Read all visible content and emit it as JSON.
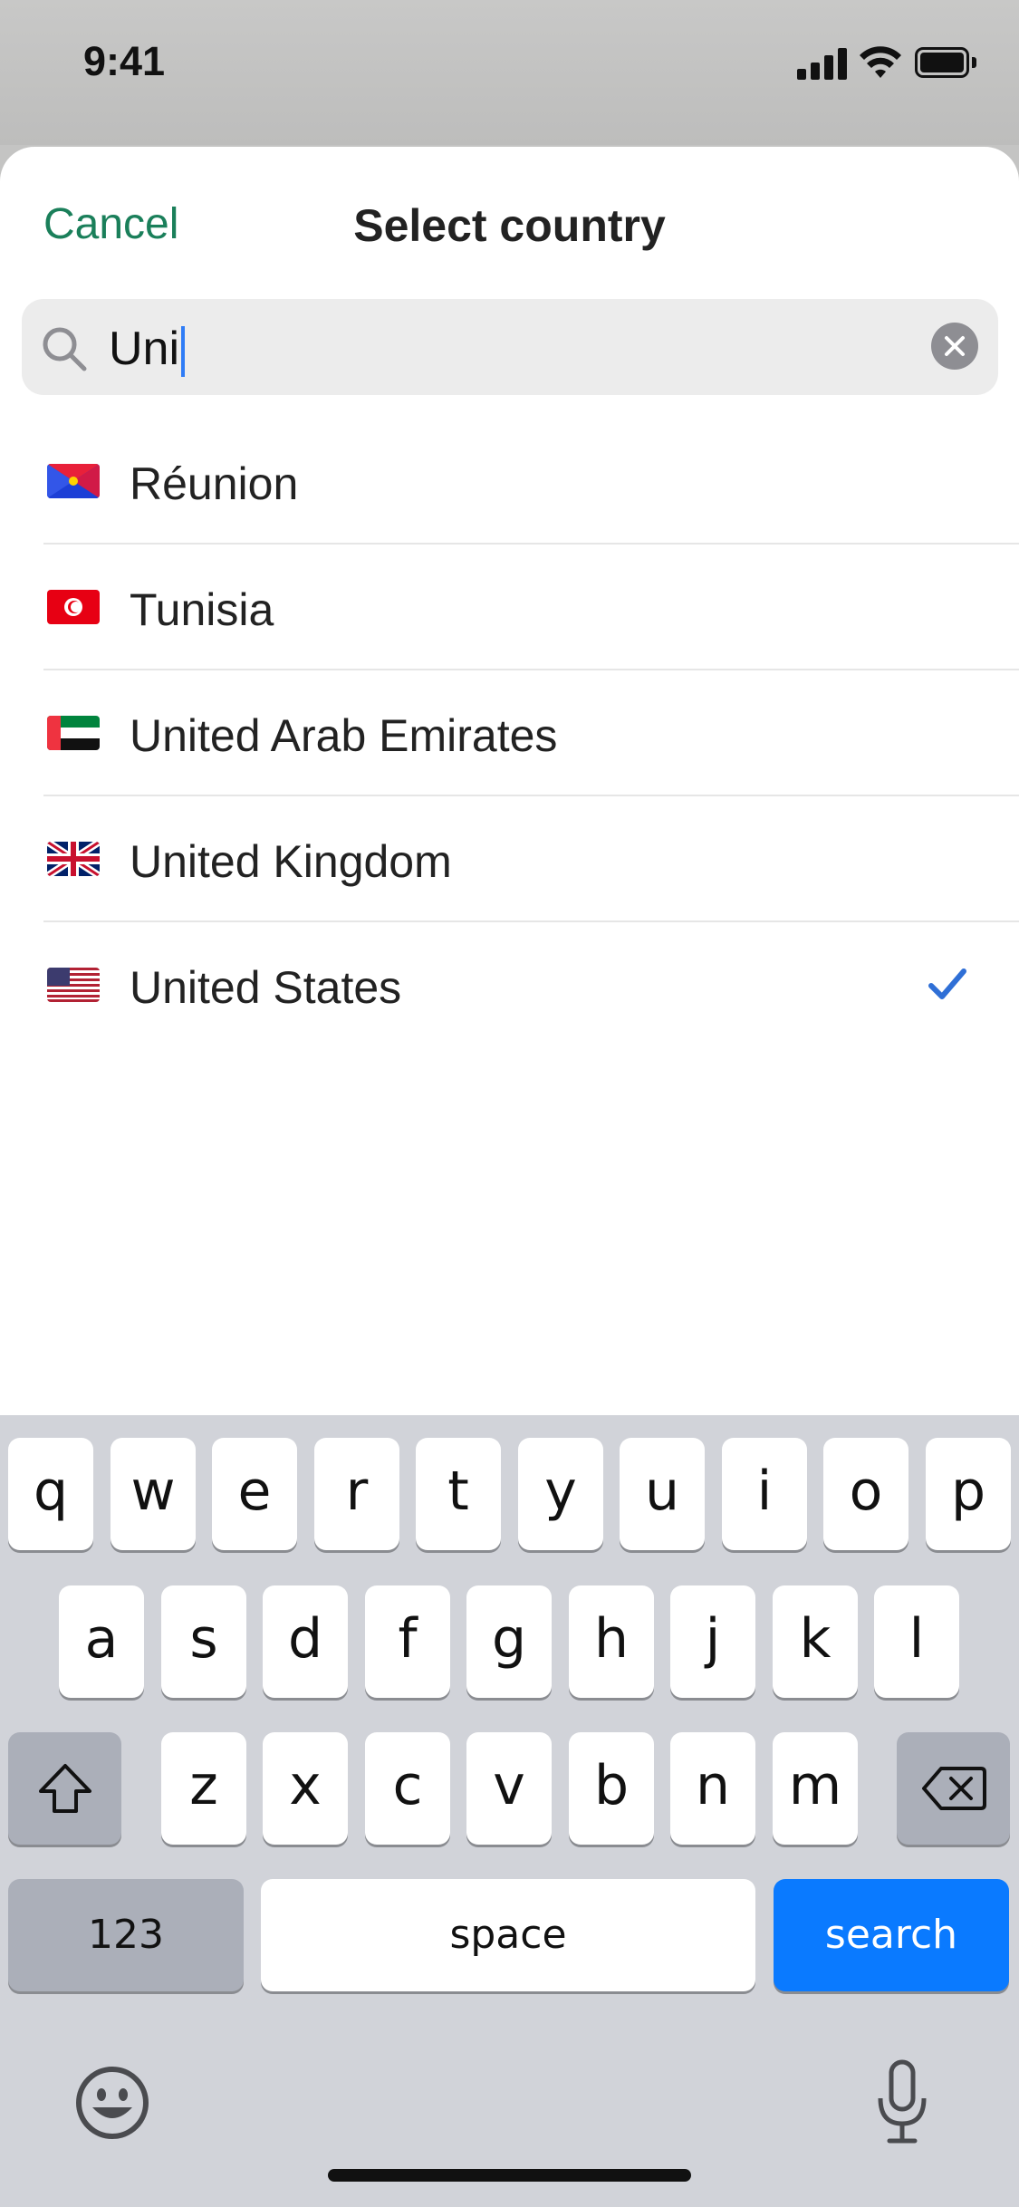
{
  "status_bar": {
    "time": "9:41"
  },
  "sheet": {
    "cancel_label": "Cancel",
    "title": "Select country"
  },
  "search": {
    "value": "Uni"
  },
  "countries": [
    {
      "name": "Réunion",
      "flag": "reunion-flag",
      "selected": false
    },
    {
      "name": "Tunisia",
      "flag": "tunisia-flag",
      "selected": false
    },
    {
      "name": "United Arab Emirates",
      "flag": "uae-flag",
      "selected": false
    },
    {
      "name": "United Kingdom",
      "flag": "uk-flag",
      "selected": false
    },
    {
      "name": "United States",
      "flag": "us-flag",
      "selected": true
    }
  ],
  "colors": {
    "accent_green": "#1a7f5a",
    "check_blue": "#2f6fd6",
    "search_key_blue": "#0a7aff"
  },
  "keyboard": {
    "row1": [
      "q",
      "w",
      "e",
      "r",
      "t",
      "y",
      "u",
      "i",
      "o",
      "p"
    ],
    "row2": [
      "a",
      "s",
      "d",
      "f",
      "g",
      "h",
      "j",
      "k",
      "l"
    ],
    "row3": [
      "z",
      "x",
      "c",
      "v",
      "b",
      "n",
      "m"
    ],
    "numbers_label": "123",
    "space_label": "space",
    "return_label": "search"
  }
}
